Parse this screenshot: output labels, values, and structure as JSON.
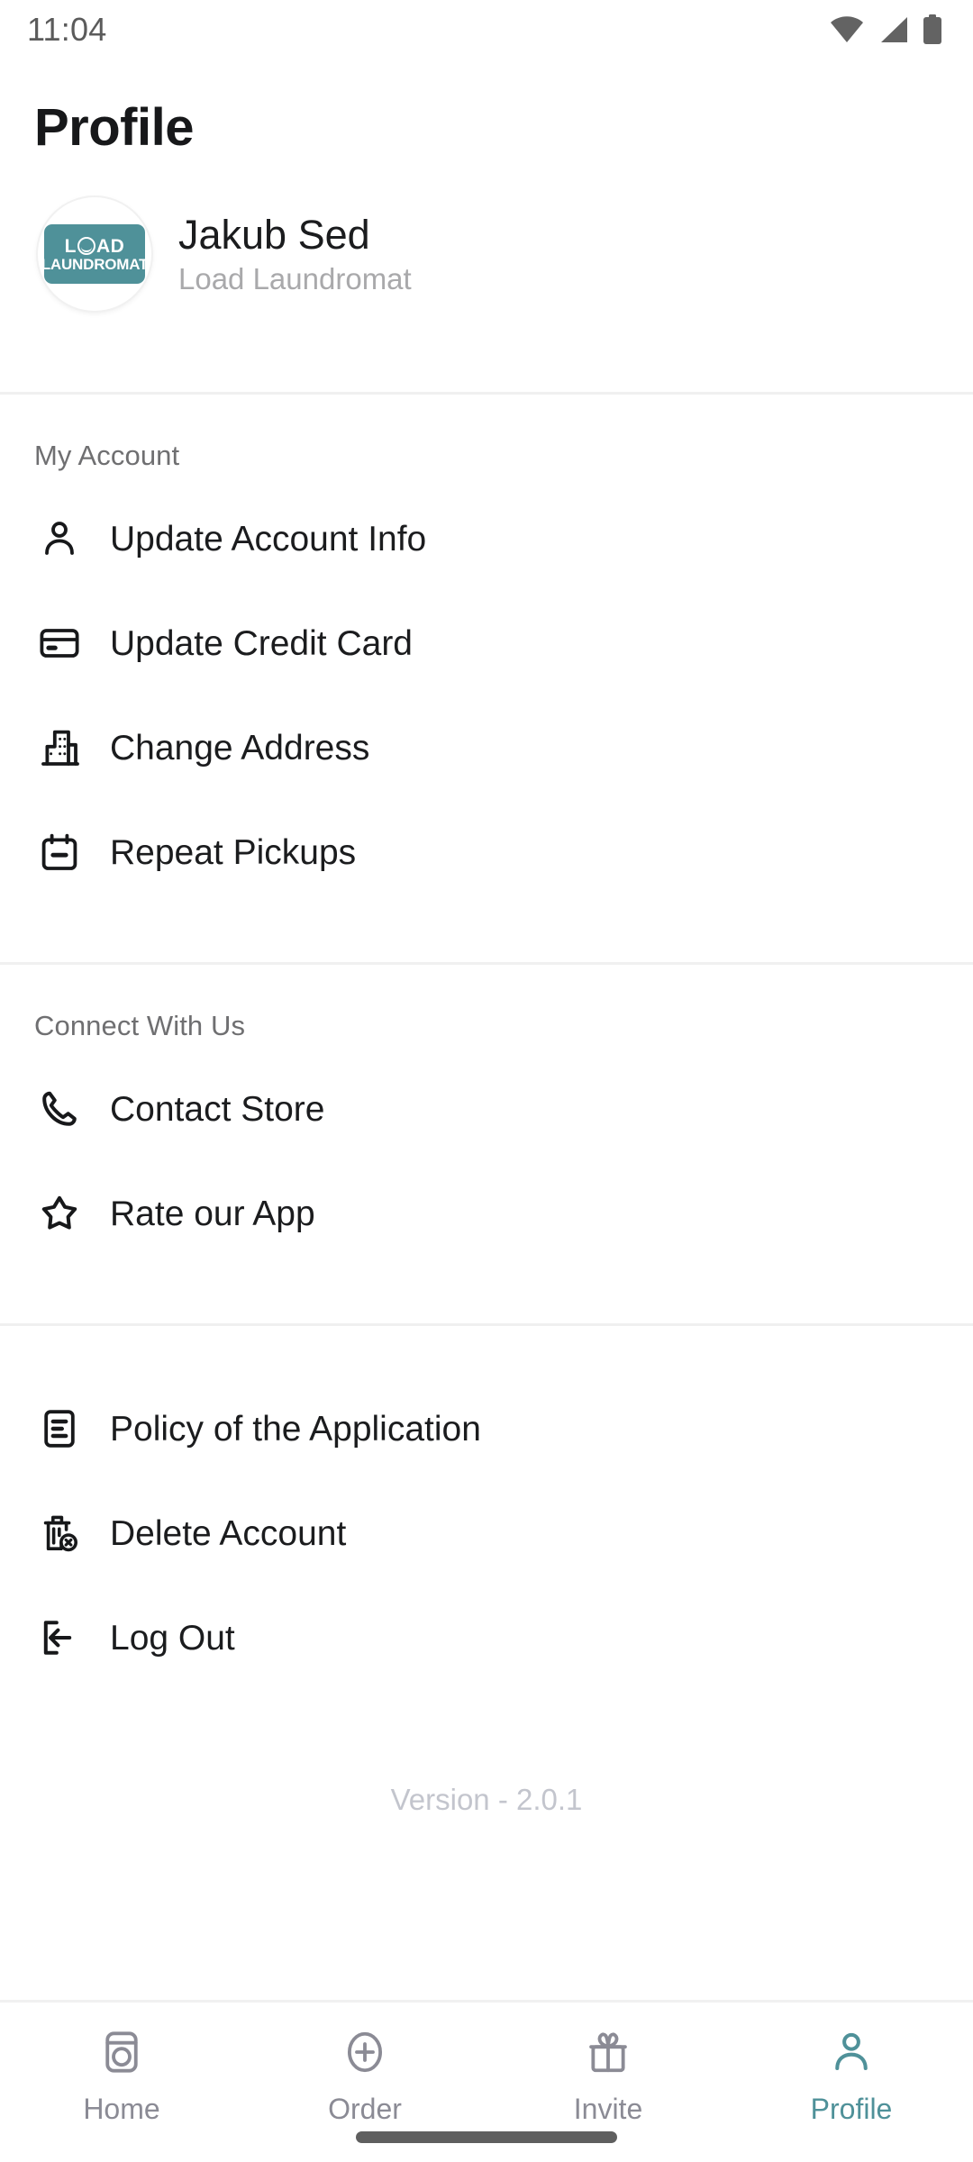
{
  "status_bar": {
    "time": "11:04",
    "icons": [
      "wifi-icon",
      "cellular-signal-icon",
      "battery-icon"
    ]
  },
  "header": {
    "title": "Profile"
  },
  "profile": {
    "name": "Jakub Sed",
    "subtitle": "Load Laundromat",
    "avatar": {
      "icon": "load-laundromat-logo",
      "logo_line1_prefix": "L",
      "logo_line1_suffix": "AD",
      "logo_line2": "LAUNDROMAT",
      "brand_color": "#4f9199"
    }
  },
  "sections": [
    {
      "label": "My Account",
      "items": [
        {
          "label": "Update Account Info",
          "icon": "person-icon"
        },
        {
          "label": "Update Credit Card",
          "icon": "credit-card-icon"
        },
        {
          "label": "Change Address",
          "icon": "building-icon"
        },
        {
          "label": "Repeat Pickups",
          "icon": "calendar-minus-icon"
        }
      ]
    },
    {
      "label": "Connect With Us",
      "items": [
        {
          "label": "Contact Store",
          "icon": "phone-icon"
        },
        {
          "label": "Rate our App",
          "icon": "star-outline-icon"
        }
      ]
    },
    {
      "label": "",
      "items": [
        {
          "label": "Policy of the Application",
          "icon": "document-lines-icon"
        },
        {
          "label": "Delete Account",
          "icon": "trash-delete-icon"
        },
        {
          "label": "Log Out",
          "icon": "logout-arrow-icon"
        }
      ]
    }
  ],
  "footer": {
    "version": "Version - 2.0.1"
  },
  "bottom_nav": {
    "active_color": "#4f9199",
    "inactive_color": "#8b8b95",
    "items": [
      {
        "label": "Home",
        "icon": "washing-machine-icon",
        "active": false
      },
      {
        "label": "Order",
        "icon": "plus-circle-icon",
        "active": false
      },
      {
        "label": "Invite",
        "icon": "gift-icon",
        "active": false
      },
      {
        "label": "Profile",
        "icon": "person-icon",
        "active": true
      }
    ]
  }
}
